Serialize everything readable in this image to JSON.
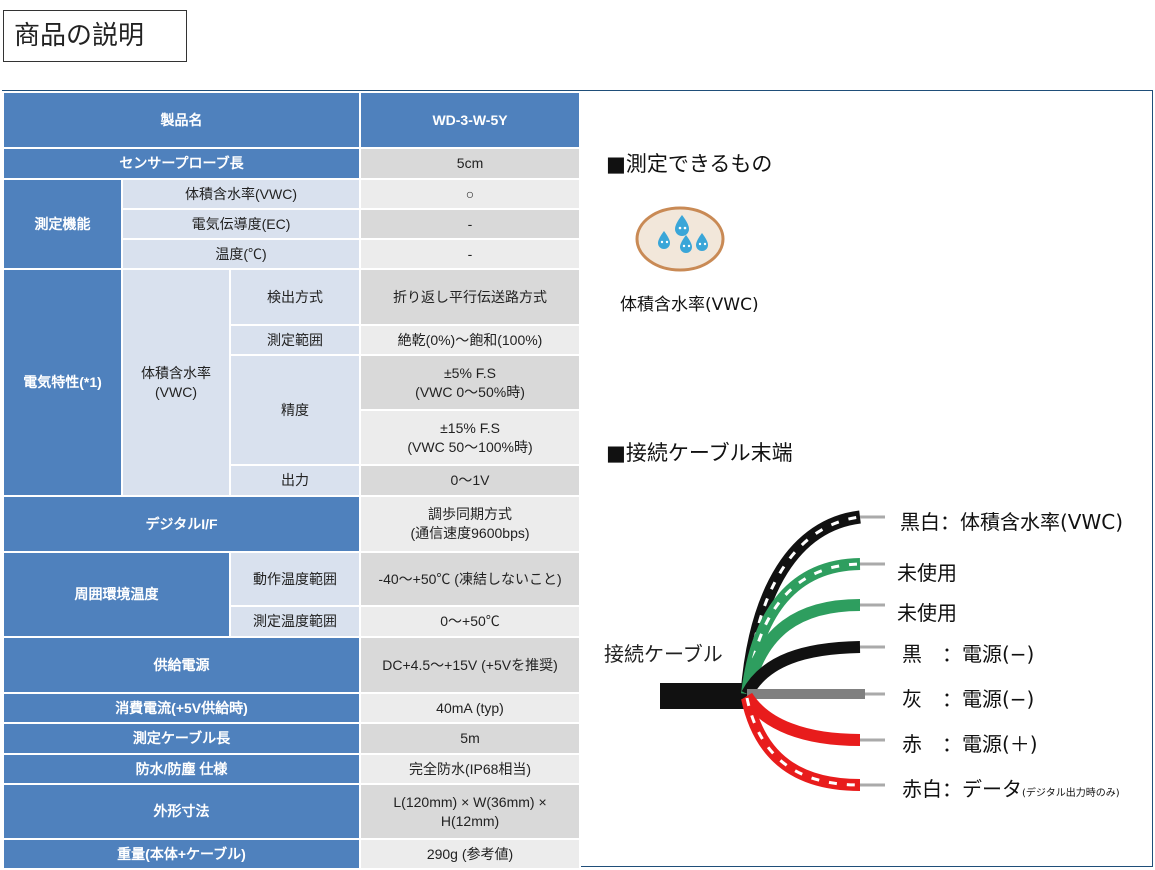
{
  "page_title": "商品の説明",
  "table": {
    "header": {
      "label": "製品名",
      "value": "WD-3-W-5Y"
    },
    "probe_length": {
      "label": "センサープローブ長",
      "value": "5cm"
    },
    "measurement": {
      "label": "測定機能",
      "items": [
        {
          "label": "体積含水率(VWC)",
          "value": "○"
        },
        {
          "label": "電気伝導度(EC)",
          "value": "-"
        },
        {
          "label": "温度(℃)",
          "value": "-"
        }
      ]
    },
    "electrical": {
      "label": "電気特性(*1)",
      "sub_label": "体積含水率\n(VWC)",
      "method": {
        "label": "検出方式",
        "value": "折り返し平行伝送路方式"
      },
      "range": {
        "label": "測定範囲",
        "value": "絶乾(0%)〜飽和(100%)"
      },
      "accuracy": {
        "label": "精度",
        "value1": "±5% F.S\n(VWC 0〜50%時)",
        "value2": "±15% F.S\n(VWC 50〜100%時)"
      },
      "output": {
        "label": "出力",
        "value": "0〜1V"
      }
    },
    "digital": {
      "label": "デジタルI/F",
      "value": "調歩同期方式\n(通信速度9600bps)"
    },
    "ambient": {
      "label": "周囲環境温度",
      "operating": {
        "label": "動作温度範囲",
        "value": "-40〜+50℃ (凍結しないこと)"
      },
      "measuring": {
        "label": "測定温度範囲",
        "value": "0〜+50℃"
      }
    },
    "power": {
      "label": "供給電源",
      "value": "DC+4.5〜+15V  (+5Vを推奨)"
    },
    "current": {
      "label": "消費電流(+5V供給時)",
      "value": "40mA (typ)"
    },
    "cable_length": {
      "label": "測定ケーブル長",
      "value": "5m"
    },
    "waterproof": {
      "label": "防水/防塵 仕様",
      "value": "完全防水(IP68相当)"
    },
    "dimensions": {
      "label": "外形寸法",
      "value": "L(120mm) × W(36mm) × H(12mm)"
    },
    "weight": {
      "label": "重量(本体+ケーブル)",
      "value": "290g (参考値)"
    }
  },
  "right_panel": {
    "measurable_title": "■測定できるもの",
    "measurable_caption": "体積含水率(VWC)",
    "cable_title": "■接続ケーブル末端",
    "cable_label": "接続ケーブル",
    "wires": [
      {
        "label": "黒白：体積含水率(VWC)",
        "note": "",
        "color": "#111111",
        "stripe": true
      },
      {
        "label": "未使用",
        "note": "",
        "color": "#2e9e5f",
        "stripe": true
      },
      {
        "label": "未使用",
        "note": "",
        "color": "#2e9e5f",
        "stripe": false
      },
      {
        "label": "黒　：電源(−)",
        "note": "",
        "color": "#111111",
        "stripe": false
      },
      {
        "label": "灰　：電源(−)",
        "note": "",
        "color": "#808080",
        "stripe": false
      },
      {
        "label": "赤　：電源(＋)",
        "note": "",
        "color": "#e81c1c",
        "stripe": false
      },
      {
        "label": "赤白：データ",
        "note": "(デジタル出力時のみ)",
        "color": "#e81c1c",
        "stripe": true
      }
    ]
  },
  "colors": {
    "header": "#4f81bd",
    "light": "#d9e1ee",
    "value": "#d9d9d9"
  }
}
